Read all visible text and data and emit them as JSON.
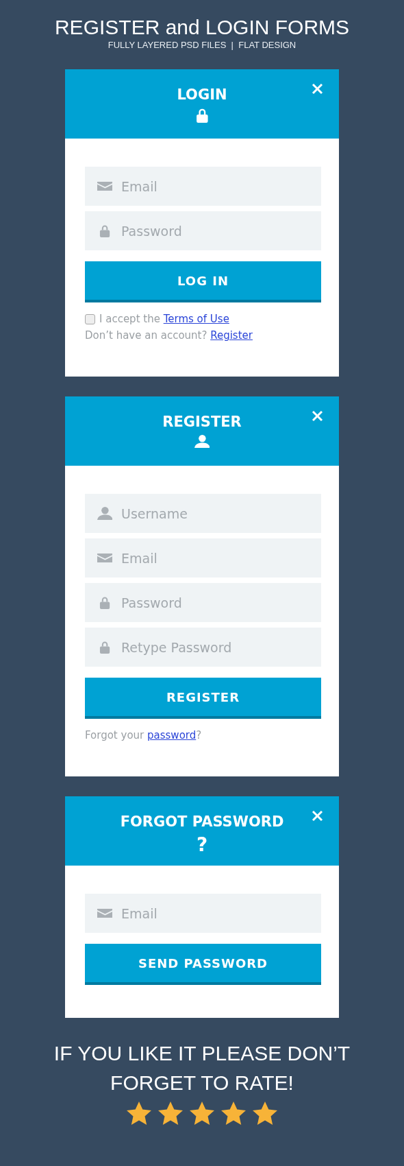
{
  "header": {
    "title": "REGISTER and LOGIN FORMS",
    "subtitle": "FULLY LAYERED PSD FILES  |  FLAT DESIGN"
  },
  "forms": [
    {
      "title": "LOGIN",
      "icon": {
        "kind": "lock"
      },
      "fields": [
        {
          "kind": "envelope",
          "placeholder": "Email"
        },
        {
          "kind": "lock",
          "placeholder": "Password"
        }
      ],
      "button": "LOG IN",
      "footer": [
        {
          "kind": "checkbox",
          "checked": false,
          "text": "I accept the ",
          "link": "Terms of Use"
        },
        {
          "kind": "text",
          "text": "Don’t have an account? ",
          "link": "Register"
        }
      ]
    },
    {
      "title": "REGISTER",
      "icon": {
        "kind": "user"
      },
      "fields": [
        {
          "kind": "user",
          "placeholder": "Username"
        },
        {
          "kind": "envelope",
          "placeholder": "Email"
        },
        {
          "kind": "lock",
          "placeholder": "Password"
        },
        {
          "kind": "lock",
          "placeholder": "Retype Password"
        }
      ],
      "button": "REGISTER",
      "footer": [
        {
          "kind": "text",
          "text": "Forgot your ",
          "link": "password",
          "after": "?"
        }
      ]
    },
    {
      "title": "FORGOT PASSWORD",
      "icon": {
        "kind": "glyph",
        "text": "?"
      },
      "fields": [
        {
          "kind": "envelope",
          "placeholder": "Email"
        }
      ],
      "button": "SEND PASSWORD"
    }
  ],
  "rating": {
    "message_lines": [
      "IF YOU LIKE IT PLEASE DON’T",
      "FORGET TO RATE!"
    ],
    "stars": 5
  }
}
